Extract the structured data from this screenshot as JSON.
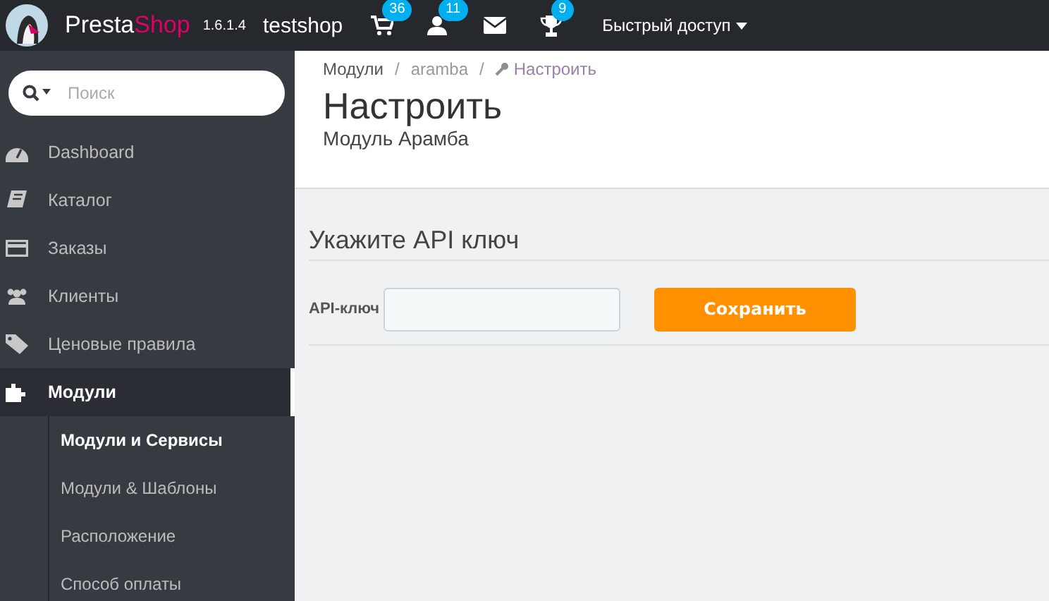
{
  "header": {
    "brand_first": "Presta",
    "brand_second": "Shop",
    "version": "1.6.1.4",
    "shop": "testshop",
    "notifications": [
      {
        "kind": "counter",
        "count": "36"
      },
      {
        "kind": "counter",
        "count": "11"
      },
      {
        "kind": "plain"
      },
      {
        "kind": "counter",
        "count": "9"
      }
    ],
    "quick_access": "Быстрый доступ"
  },
  "sidebar": {
    "search": {
      "placeholder": "Поиск"
    },
    "items": [
      {
        "label": "Dashboard",
        "selected": false
      },
      {
        "label": "Каталог",
        "selected": false
      },
      {
        "label": "Заказы",
        "selected": false
      },
      {
        "label": "Клиенты",
        "selected": false
      },
      {
        "label": "Ценовые правила",
        "selected": false
      },
      {
        "label": "Модули",
        "selected": true,
        "children": [
          {
            "label": "Модули и Сервисы",
            "selected": true
          },
          {
            "label": "Модули & Шаблоны",
            "selected": false
          },
          {
            "label": "Расположение",
            "selected": false
          },
          {
            "label": "Способ оплаты",
            "selected": false
          }
        ]
      }
    ]
  },
  "breadcrumb": [
    "Модули",
    "aramba",
    "Настроить"
  ],
  "breadcrumb_separator": "/",
  "page_title": "Настроить",
  "page_subtitle": "Модуль Арамба",
  "panel": {
    "title": "Укажите API ключ",
    "field_label": "API-ключ",
    "button": "Сохранить"
  }
}
